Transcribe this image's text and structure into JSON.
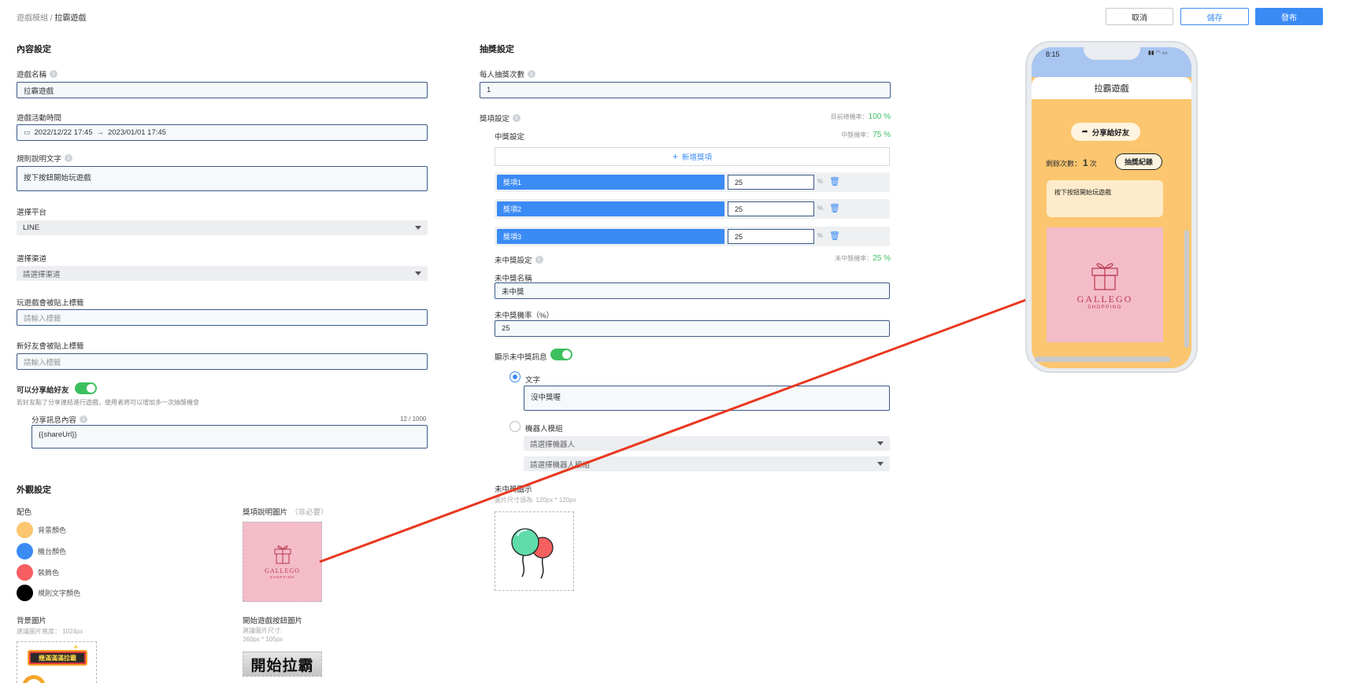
{
  "breadcrumb": {
    "parent": "遊戲模組",
    "sep": "/",
    "current": "拉霸遊戲"
  },
  "actions": {
    "cancel": "取消",
    "save": "儲存",
    "publish": "發布"
  },
  "content": {
    "title": "內容設定",
    "game_name_label": "遊戲名稱",
    "game_name_value": "拉霸遊戲",
    "time_label": "遊戲活動時間",
    "time_start": "2022/12/22 17:45",
    "time_arrow": "→",
    "time_end": "2023/01/01 17:45",
    "rules_label": "規則說明文字",
    "rules_value": "按下按鈕開始玩遊戲",
    "platform_label": "選擇平台",
    "platform_value": "LINE",
    "channel_label": "選擇渠道",
    "channel_placeholder": "請選擇渠道",
    "play_tag_label": "玩遊戲會被貼上標籤",
    "play_tag_placeholder": "請輸入標籤",
    "friend_tag_label": "新好友會被貼上標籤",
    "friend_tag_placeholder": "請輸入標籤",
    "share_label": "可以分享給好友",
    "share_hint": "若好友點了分享連結進行遊戲，使用者將可以增加多一次抽獎機會",
    "share_msg_label": "分享訊息內容",
    "share_msg_count": "12 / 1000",
    "share_msg_value": "{{shareUrl}}"
  },
  "appearance": {
    "title": "外觀設定",
    "color_label": "配色",
    "colors": [
      {
        "name": "背景顏色",
        "hex": "#fbc66f"
      },
      {
        "name": "機台顏色",
        "hex": "#3b8bf5"
      },
      {
        "name": "裝飾色",
        "hex": "#f65e62"
      },
      {
        "name": "規則文字顏色",
        "hex": "#000000"
      }
    ],
    "prize_img_label": "獎項說明圖片",
    "prize_img_optional": "（非必要）",
    "bg_img_label": "背景圖片",
    "bg_img_hint": "建議圖片寬度： 1024px",
    "start_btn_label": "開始遊戲按鈕圖片",
    "start_btn_hint1": "建議圖片尺寸:",
    "start_btn_hint2": "360px * 105px",
    "start_btn_text": "開始拉霸",
    "banner_text": "幾滿滿滿拉霸",
    "logo_main": "GALLEGO",
    "logo_sub": "SHOPPING"
  },
  "lottery": {
    "title": "抽獎設定",
    "draws_label": "每人抽獎次數",
    "draws_value": "1",
    "prize_label": "獎項設定",
    "total_rate_label": "目前總機率：",
    "total_rate_value": "100 %",
    "win_label": "中獎設定",
    "win_rate_label": "中獎機率：",
    "win_rate_value": "75 %",
    "add_prize": "新增獎項",
    "prizes": [
      {
        "name": "獎項1",
        "rate": "25",
        "unit": "%"
      },
      {
        "name": "獎項2",
        "rate": "25",
        "unit": "%"
      },
      {
        "name": "獎項3",
        "rate": "25",
        "unit": "%"
      }
    ],
    "lose_label": "未中獎設定",
    "lose_rate_label": "未中獎機率：",
    "lose_rate_value": "25 %",
    "lose_name_label": "未中獎名稱",
    "lose_name_value": "未中獎",
    "lose_pct_label": "未中獎機率（%）",
    "lose_pct_value": "25",
    "show_msg_label": "顯示未中獎訊息",
    "text_option": "文字",
    "text_value": "沒中獎喔",
    "bot_option": "機器人模組",
    "bot_placeholder": "請選擇機器人",
    "bot_module_placeholder": "請選擇機器人模組",
    "lose_img_label": "未中獎圖示",
    "lose_img_hint": "圖片尺寸須為: 120px * 120px"
  },
  "preview": {
    "time": "8:15",
    "title": "拉霸遊戲",
    "share_btn": "分享給好友",
    "remaining_label": "剩餘次數：",
    "remaining_value": "1",
    "remaining_unit": "次",
    "record_btn": "抽獎紀錄",
    "rules_text": "按下按鈕開始玩遊戲",
    "logo_main": "GALLEGO",
    "logo_sub": "SHOPPING"
  }
}
